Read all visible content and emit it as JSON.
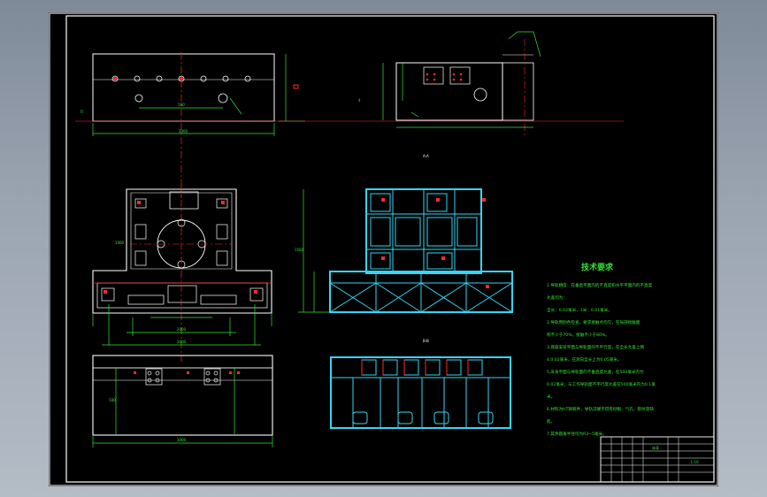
{
  "colors": {
    "background": "#000000",
    "frame": "#ffffff",
    "geometry": "#ffffff",
    "centerline": "#ff2a2a",
    "dimension": "#36e336",
    "section": "#35d6f5",
    "notes": "#36e336"
  },
  "views": {
    "top_front": {
      "overall_width": "3000",
      "hole_pitch": "500"
    },
    "side": {
      "ref_height": "4"
    },
    "main": {
      "height": "1000",
      "width": "2000",
      "base_width": "3000"
    },
    "bottom": {
      "width": "3000",
      "height": "500"
    },
    "section_a": {
      "label": "A-A",
      "height": "1500"
    },
    "section_b": {
      "label": "B-B"
    }
  },
  "technical_requirements": {
    "title": "技术要求",
    "items": [
      "1.导轨精度：在垂直平面内的不直度和水平平面内的不直度",
      "允差均为：",
      "全长：0.02毫米，1米：0.01毫米。",
      "2.导轨用刮色检查，要求接触点均匀，在局部接触面",
      "积不少于70%，接触不少于80%。",
      "3.底座安装平面与导轨面的不平行度，在全长允差上侧",
      "4.0.02毫米，在测向全长上为0.05毫米。",
      "5.床身平面与导轨面的不垂直度允差，在500毫米内为",
      "0.02毫米；与工作导轨面不平行度允差在500毫米内为0.1毫",
      "米。",
      "6.材料为HT铸铁件，导轨淬硬不得有砂眼、气孔、裂纹等缺",
      "陷。",
      "7.其余圆角半径均为R3~5毫米。"
    ]
  },
  "title_block": {
    "name": "床身",
    "scale": "1:10"
  }
}
